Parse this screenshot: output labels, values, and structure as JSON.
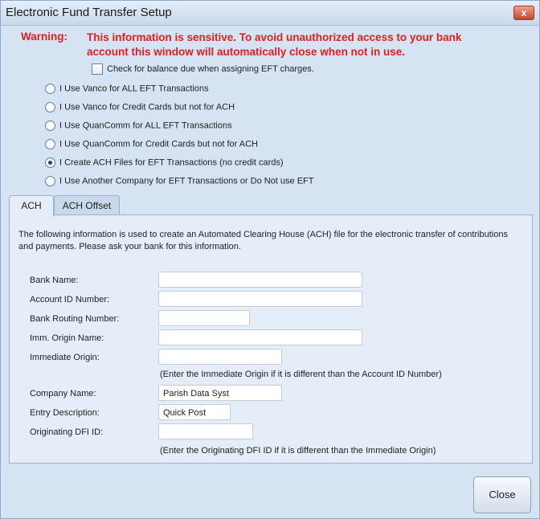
{
  "window": {
    "title": "Electronic Fund Transfer Setup",
    "close_glyph": "x"
  },
  "warning": {
    "label": "Warning:",
    "text": "This information is sensitive. To avoid unauthorized access to your bank account this window will automatically close when not in use."
  },
  "balance_check": {
    "label": "Check for balance due when assigning EFT charges.",
    "checked": false
  },
  "radios": [
    {
      "label": "I Use Vanco for ALL EFT Transactions",
      "checked": false
    },
    {
      "label": "I Use Vanco for Credit Cards but not for ACH",
      "checked": false
    },
    {
      "label": "I Use QuanComm for ALL EFT Transactions",
      "checked": false
    },
    {
      "label": "I Use QuanComm for Credit Cards but not for ACH",
      "checked": false
    },
    {
      "label": "I Create ACH Files for EFT Transactions (no credit cards)",
      "checked": true
    },
    {
      "label": "I Use Another Company for EFT Transactions or Do Not use EFT",
      "checked": false
    }
  ],
  "tabs": [
    {
      "label": "ACH",
      "active": true
    },
    {
      "label": "ACH Offset",
      "active": false
    }
  ],
  "ach": {
    "description": "The following information is used to create an Automated Clearing House (ACH) file for the electronic transfer of contributions and payments. Please ask your bank for this information.",
    "fields": {
      "bank_name": {
        "label": "Bank Name:",
        "value": ""
      },
      "account_id": {
        "label": "Account ID Number:",
        "value": ""
      },
      "routing": {
        "label": "Bank Routing Number:",
        "value": ""
      },
      "imm_origin_name": {
        "label": "Imm. Origin Name:",
        "value": ""
      },
      "immediate_origin": {
        "label": "Immediate Origin:",
        "value": ""
      },
      "company_name": {
        "label": "Company Name:",
        "value": "Parish Data Syst"
      },
      "entry_description": {
        "label": "Entry Description:",
        "value": "Quick Post"
      },
      "originating_dfi": {
        "label": "Originating DFI ID:",
        "value": ""
      }
    },
    "hint_immediate_origin": "(Enter the Immediate Origin if it is different than the Account ID Number)",
    "hint_dfi": "(Enter the Originating DFI ID if it is different than the Immediate Origin)"
  },
  "buttons": {
    "close": "Close"
  }
}
